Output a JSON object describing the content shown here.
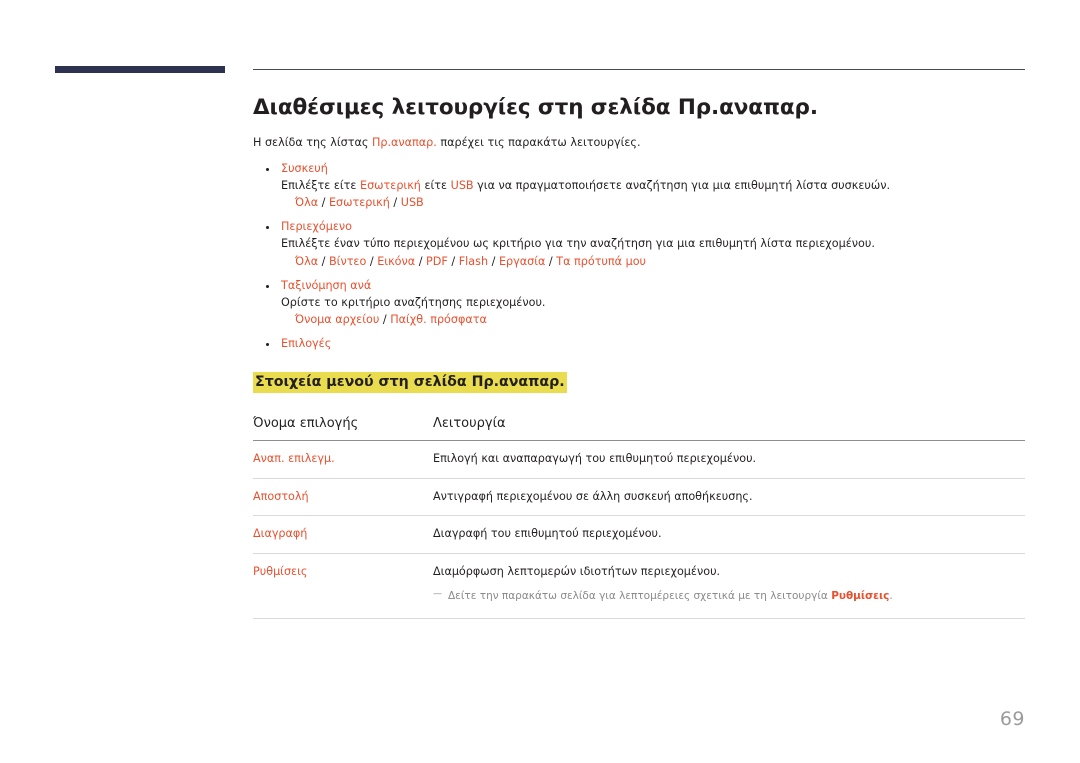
{
  "page": {
    "number": "69",
    "accent_color": "#e8502e",
    "highlight_color": "#e9dd4f",
    "brand_rule_color": "#2e3251",
    "body_color": "#231f20",
    "note_color": "#8a8a8a"
  },
  "title": "Διαθέσιμες λειτουργίες στη σελίδα Πρ.αναπαρ.",
  "intro": {
    "before": "Η σελίδα της λίστας ",
    "accent": "Πρ.αναπαρ.",
    "after": " παρέχει τις παρακάτω λειτουργίες."
  },
  "features": [
    {
      "label": "Συσκευή",
      "desc_before": "Επιλέξτε είτε ",
      "desc_accent1": "Εσωτερική",
      "desc_middle": " είτε ",
      "desc_accent2": "USB",
      "desc_after": " για να πραγματοποιήσετε αναζήτηση για μια επιθυμητή λίστα συσκευών.",
      "options": [
        "Όλα",
        "Εσωτερική",
        "USB"
      ]
    },
    {
      "label": "Περιεχόμενο",
      "desc_before": "Επιλέξτε έναν τύπο περιεχομένου ως κριτήριο για την αναζήτηση για μια επιθυμητή λίστα περιεχομένου.",
      "desc_accent1": "",
      "desc_middle": "",
      "desc_accent2": "",
      "desc_after": "",
      "options": [
        "Όλα",
        "Βίντεο",
        "Εικόνα",
        "PDF",
        "Flash",
        "Εργασία",
        "Τα πρότυπά μου"
      ]
    },
    {
      "label": "Ταξινόμηση ανά",
      "desc_before": "Ορίστε το κριτήριο αναζήτησης περιεχομένου.",
      "desc_accent1": "",
      "desc_middle": "",
      "desc_accent2": "",
      "desc_after": "",
      "options": [
        "Όνομα αρχείου",
        "Παίχθ. πρόσφατα"
      ]
    },
    {
      "label": "Επιλογές",
      "desc_before": "",
      "desc_accent1": "",
      "desc_middle": "",
      "desc_accent2": "",
      "desc_after": "",
      "options": []
    }
  ],
  "section_heading": "Στοιχεία μενού στη σελίδα Πρ.αναπαρ.",
  "table": {
    "headers": [
      "Όνομα επιλογής",
      "Λειτουργία"
    ],
    "rows": [
      {
        "name": "Αναπ. επιλεγμ.",
        "func": "Επιλογή και αναπαραγωγή του επιθυμητού περιεχομένου.",
        "note_before": "",
        "note_accent": "",
        "note_after": ""
      },
      {
        "name": "Αποστολή",
        "func": "Αντιγραφή περιεχομένου σε άλλη συσκευή αποθήκευσης.",
        "note_before": "",
        "note_accent": "",
        "note_after": ""
      },
      {
        "name": "Διαγραφή",
        "func": "Διαγραφή του επιθυμητού περιεχομένου.",
        "note_before": "",
        "note_accent": "",
        "note_after": ""
      },
      {
        "name": "Ρυθμίσεις",
        "func": "Διαμόρφωση λεπτομερών ιδιοτήτων περιεχομένου.",
        "note_before": "Δείτε την παρακάτω σελίδα για λεπτομέρειες σχετικά με τη λειτουργία ",
        "note_accent": "Ρυθμίσεις",
        "note_after": "."
      }
    ]
  }
}
